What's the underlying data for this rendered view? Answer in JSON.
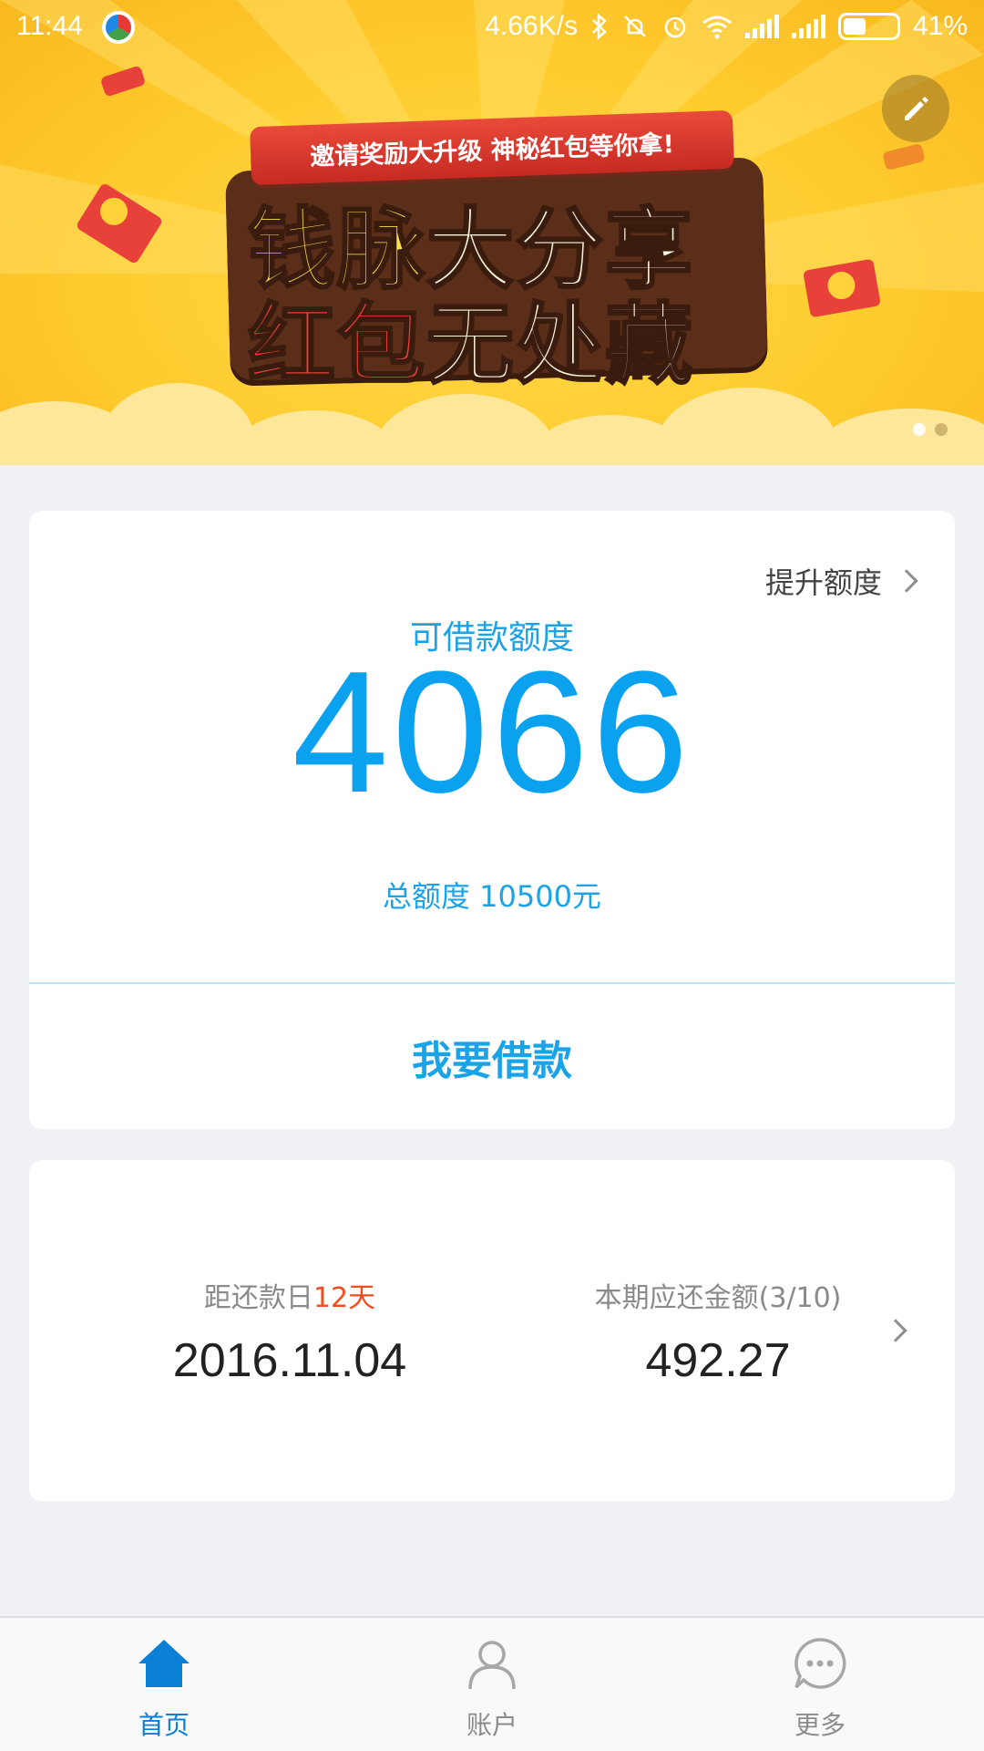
{
  "status_bar": {
    "time": "11:44",
    "net_speed": "4.66K/s",
    "battery": "41%",
    "icons": [
      "app-notification-icon",
      "bluetooth-icon",
      "mute-icon",
      "alarm-icon",
      "wifi-icon",
      "signal-icon",
      "signal-icon",
      "battery-icon"
    ]
  },
  "banner": {
    "top_text": "邀请奖励大升级  神秘红包等你拿!",
    "line1_a": "钱脉",
    "line1_b": "大分享",
    "line2_a": "红包",
    "line2_b": "无处藏",
    "edit_icon": "pencil-icon",
    "page_dots": {
      "count": 2,
      "active": 0
    }
  },
  "credit": {
    "raise_label": "提升额度",
    "available_label": "可借款额度",
    "available_value": "4066",
    "total_line": "总额度 10500元",
    "borrow_button": "我要借款"
  },
  "repayment": {
    "due_label_prefix": "距还款日",
    "due_days": "12天",
    "due_date": "2016.11.04",
    "amount_label": "本期应还金额(3/10)",
    "amount_value": "492.27"
  },
  "nav": [
    {
      "label": "首页",
      "icon": "home-icon",
      "active": true
    },
    {
      "label": "账户",
      "icon": "person-icon",
      "active": false
    },
    {
      "label": "更多",
      "icon": "more-chat-icon",
      "active": false
    }
  ],
  "colors": {
    "accent": "#0aa1ee",
    "highlight": "#f04e1e",
    "nav_active": "#0a7fd6",
    "banner_yellow": "#ffcc2e"
  }
}
